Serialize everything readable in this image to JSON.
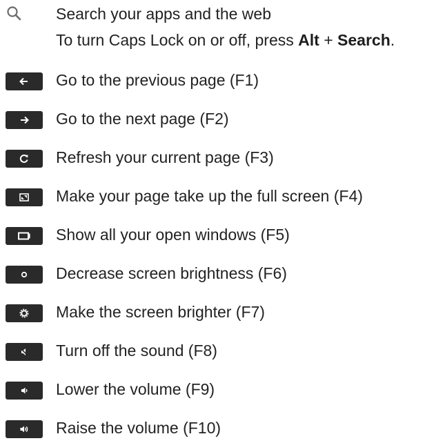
{
  "search": {
    "icon": "search-icon",
    "title": "Search your apps and the web",
    "hint_prefix": "To turn Caps Lock on or off, press ",
    "hint_key1": "Alt",
    "hint_plus": " + ",
    "hint_key2": "Search",
    "hint_suffix": "."
  },
  "shortcuts": [
    {
      "icon": "back-arrow-icon",
      "label": "Go to the previous page (F1)"
    },
    {
      "icon": "forward-arrow-icon",
      "label": "Go to the next page (F2)"
    },
    {
      "icon": "refresh-icon",
      "label": "Refresh your current page (F3)"
    },
    {
      "icon": "fullscreen-icon",
      "label": "Make your page take up the full screen (F4)"
    },
    {
      "icon": "overview-windows-icon",
      "label": "Show all your open windows (F5)"
    },
    {
      "icon": "brightness-down-icon",
      "label": "Decrease screen brightness (F6)"
    },
    {
      "icon": "brightness-up-icon",
      "label": "Make the screen brighter (F7)"
    },
    {
      "icon": "mute-icon",
      "label": "Turn off the sound (F8)"
    },
    {
      "icon": "volume-down-icon",
      "label": "Lower the volume (F9)"
    },
    {
      "icon": "volume-up-icon",
      "label": "Raise the volume (F10)"
    }
  ],
  "colors": {
    "key_background": "#2a2a2a",
    "key_glyph": "#ffffff",
    "text": "#222222",
    "search_icon": "#6b6b6b"
  }
}
